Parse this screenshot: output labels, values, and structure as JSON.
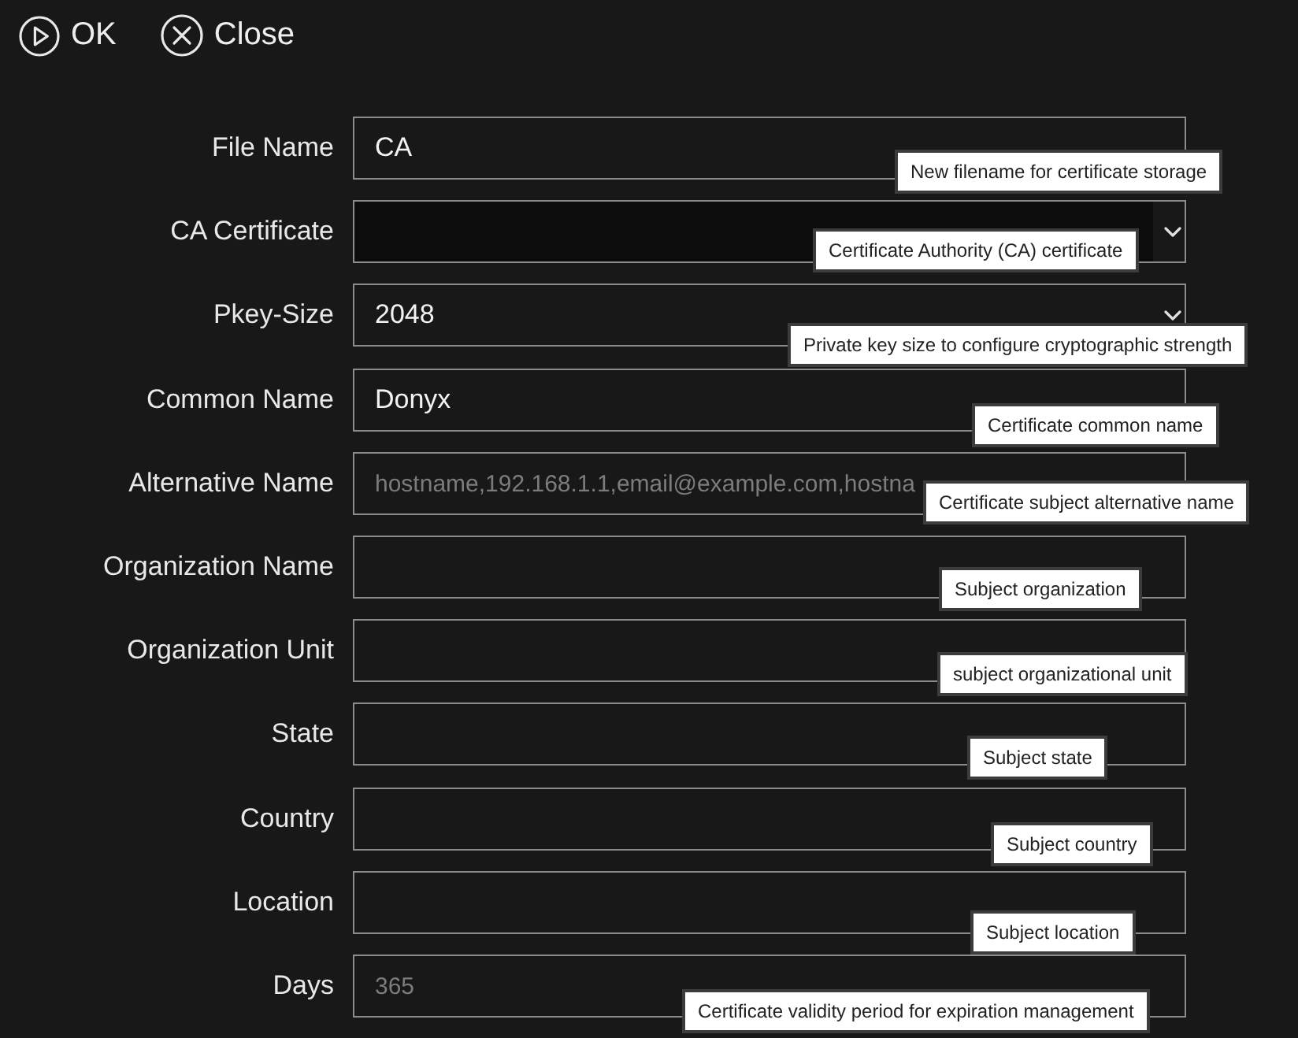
{
  "toolbar": {
    "buttons": [
      {
        "label": "OK",
        "kind": "ok"
      },
      {
        "label": "Close",
        "kind": "close"
      }
    ]
  },
  "form": {
    "fields": [
      {
        "label": "File Name",
        "kind": "text",
        "value": "CA",
        "tooltip": "New filename for certificate storage"
      },
      {
        "label": "CA Certificate",
        "kind": "select",
        "tooltip": "Certificate Authority (CA) certificate"
      },
      {
        "label": "Pkey-Size",
        "kind": "select",
        "value": "2048",
        "tooltip": "Private key size to configure cryptographic strength"
      },
      {
        "label": "Common Name",
        "kind": "text",
        "value": "Donyx",
        "tooltip": "Certificate common name"
      },
      {
        "label": "Alternative Name",
        "kind": "text",
        "placeholder": "hostname,192.168.1.1,email@example.com,hostna",
        "tooltip": "Certificate subject alternative name"
      },
      {
        "label": "Organization Name",
        "kind": "text",
        "tooltip": "Subject organization"
      },
      {
        "label": "Organization Unit",
        "kind": "text",
        "tooltip": "subject organizational unit"
      },
      {
        "label": "State",
        "kind": "text",
        "tooltip": "Subject state"
      },
      {
        "label": "Country",
        "kind": "text",
        "tooltip": "Subject country"
      },
      {
        "label": "Location",
        "kind": "text",
        "tooltip": "Subject location"
      },
      {
        "label": "Days",
        "kind": "text",
        "placeholder": "365",
        "tooltip": "Certificate validity period for expiration management"
      }
    ]
  }
}
